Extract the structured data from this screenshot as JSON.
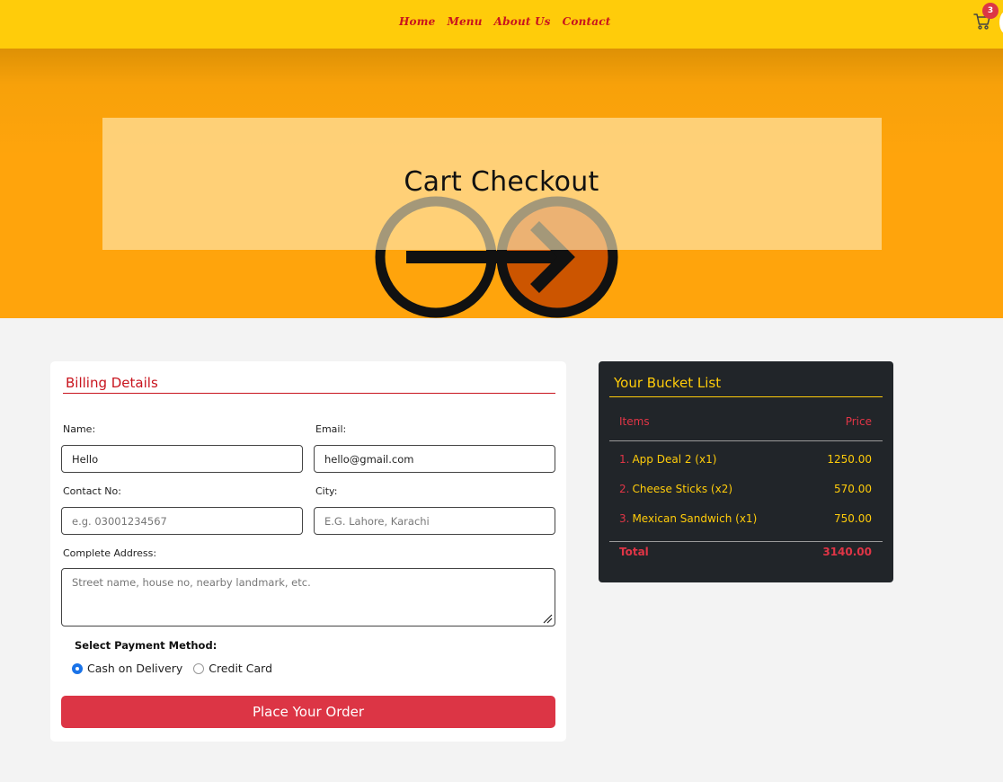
{
  "nav": {
    "links": [
      "Home",
      "Menu",
      "About Us",
      "Contact"
    ],
    "cart_count": "3"
  },
  "hero": {
    "title": "Cart Checkout"
  },
  "billing": {
    "heading": "Billing Details",
    "fields": {
      "name": {
        "label": "Name:",
        "value": "Hello",
        "placeholder": ""
      },
      "email": {
        "label": "Email:",
        "value": "hello@gmail.com",
        "placeholder": ""
      },
      "contact": {
        "label": "Contact No:",
        "value": "",
        "placeholder": "e.g. 03001234567"
      },
      "city": {
        "label": "City:",
        "value": "",
        "placeholder": "E.G. Lahore, Karachi"
      },
      "address": {
        "label": "Complete Address:",
        "value": "",
        "placeholder": "Street name, house no, nearby landmark, etc."
      }
    },
    "payment": {
      "title": "Select Payment Method:",
      "options": [
        "Cash on Delivery",
        "Credit Card"
      ],
      "selected": "Cash on Delivery"
    },
    "submit_label": "Place Your Order"
  },
  "bucket": {
    "title": "Your Bucket List",
    "col_items": "Items",
    "col_price": "Price",
    "items": [
      {
        "num": "1.",
        "name": "App Deal 2 (x1)",
        "price": "1250.00"
      },
      {
        "num": "2.",
        "name": "Cheese Sticks (x2)",
        "price": "570.00"
      },
      {
        "num": "3.",
        "name": "Mexican Sandwich (x1)",
        "price": "750.00"
      }
    ],
    "total_label": "Total",
    "total_value": "3140.00"
  },
  "colors": {
    "nav_bg": "#ffcc0a",
    "hero_bg": "#ffa40c",
    "accent_red": "#dc3545",
    "heading_red": "#c8141e",
    "dark_card": "#212529",
    "radio_blue": "#1a73e8"
  }
}
